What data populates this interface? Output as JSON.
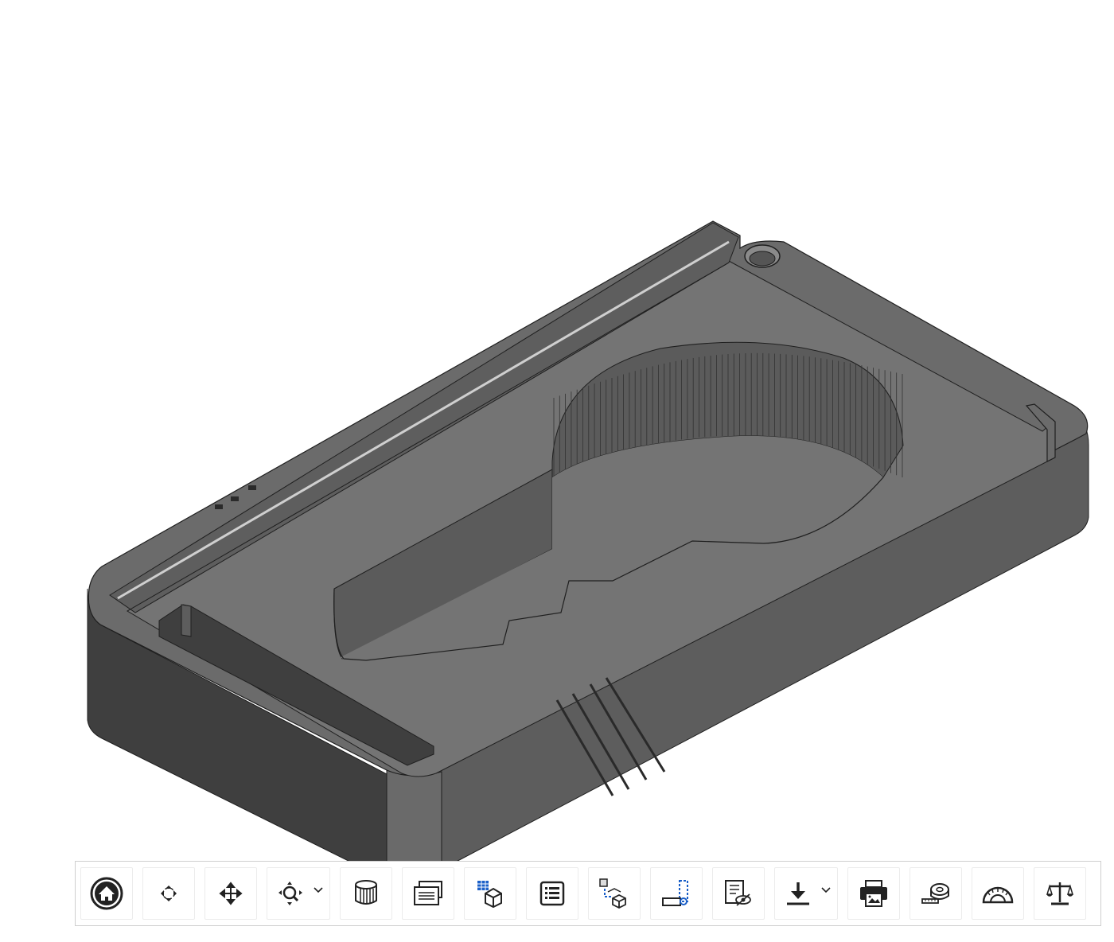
{
  "viewport": {
    "model_name": "key-holder-box",
    "colors": {
      "top_face": "#6b6b6b",
      "floor": "#747474",
      "left_side": "#3f3f3f",
      "front_side": "#5d5d5d",
      "pocket_wall": "#5b5b5b",
      "edge": "#1f1f1f",
      "rail_highlight": "#cfcfcf",
      "background": "#ffffff"
    }
  },
  "toolbar": {
    "buttons": [
      {
        "name": "home-view-button",
        "icon": "home-icon",
        "dropdown": false
      },
      {
        "name": "rotate-button",
        "icon": "rotate-icon",
        "dropdown": false
      },
      {
        "name": "pan-button",
        "icon": "move-icon",
        "dropdown": false
      },
      {
        "name": "zoom-button",
        "icon": "zoom-icon",
        "dropdown": true
      },
      {
        "name": "section-view-button",
        "icon": "section-icon",
        "dropdown": false
      },
      {
        "name": "named-views-button",
        "icon": "views-icon",
        "dropdown": false
      },
      {
        "name": "parts-list-button",
        "icon": "parts-table-icon",
        "dropdown": false
      },
      {
        "name": "properties-button",
        "icon": "properties-icon",
        "dropdown": false
      },
      {
        "name": "explode-button",
        "icon": "explode-icon",
        "dropdown": false
      },
      {
        "name": "sectioning-button",
        "icon": "clip-plane-icon",
        "dropdown": false
      },
      {
        "name": "hide-show-button",
        "icon": "visibility-icon",
        "dropdown": false
      },
      {
        "name": "download-button",
        "icon": "download-icon",
        "dropdown": true
      },
      {
        "name": "print-button",
        "icon": "print-icon",
        "dropdown": false
      },
      {
        "name": "measure-button",
        "icon": "tape-measure-icon",
        "dropdown": false
      },
      {
        "name": "angle-button",
        "icon": "protractor-icon",
        "dropdown": false
      },
      {
        "name": "mass-properties-button",
        "icon": "scale-icon",
        "dropdown": false
      }
    ]
  }
}
